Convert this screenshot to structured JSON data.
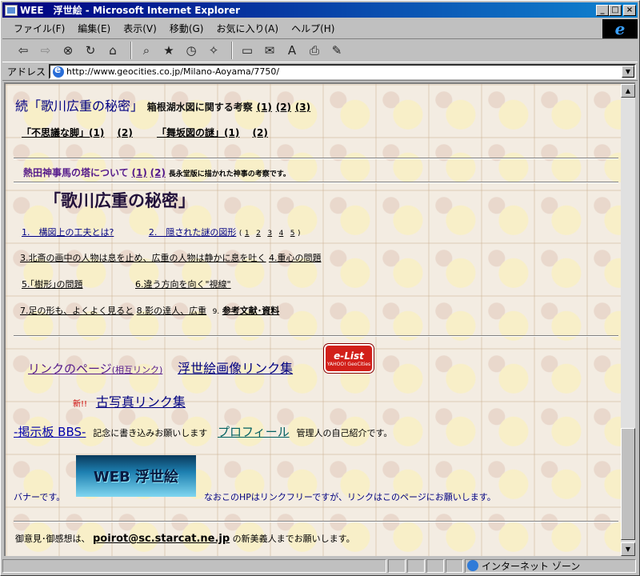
{
  "window": {
    "title": "WEE　浮世絵 - Microsoft Internet Explorer"
  },
  "menu": [
    "ファイル(F)",
    "編集(E)",
    "表示(V)",
    "移動(G)",
    "お気に入り(A)",
    "ヘルプ(H)"
  ],
  "address": {
    "label": "アドレス",
    "url": "http://www.geocities.co.jp/Milano-Aoyama/7750/"
  },
  "status": {
    "zone": "インターネット ゾーン"
  },
  "page": {
    "line1": {
      "title": "続「歌川広重の秘密」",
      "subtitle": "箱根湖水図に関する考察",
      "links": [
        "(1)",
        "(2)",
        "(3)"
      ]
    },
    "line2": {
      "a": "「不思議な脚」(1)",
      "a2": "(2)",
      "b": "「舞坂図の謎」(1)",
      "b2": "(2)"
    },
    "line3": {
      "text": "熱田神事馬の塔について",
      "links": [
        "(1)",
        "(2)"
      ],
      "note": "長永堂版に描かれた神事の考察です。"
    },
    "heading": "「歌川広重の秘密」",
    "toc": {
      "i1": "1.　構図上の工夫とは?",
      "i2": "2.　隠された謎の図形",
      "i2nums": [
        "1",
        "2",
        "3",
        "4",
        "5"
      ],
      "i2open": "(",
      "i2close": ")",
      "i3": "3.北斎の画中の人物は息を止め、広重の人物は静かに息を吐く",
      "i4": "4.重心の問題",
      "i5": "5.｢樹形｣の問題",
      "i6": "6.違う方向を向く\"視線\"",
      "i7": "7.足の形も、よくよく見ると",
      "i8": "8.影の達人、広重",
      "i9num": "9.",
      "i9": "参考文献･資料"
    },
    "links": {
      "link_page": "リンクのページ",
      "mutual": "(相互リンク)",
      "ukiyoe_links": "浮世絵画像リンク集",
      "new": "新!!",
      "photo_links": "古写真リンク集",
      "bbs": "-掲示板 BBS-",
      "bbs_desc": "記念に書き込みお願いします",
      "profile": "プロフィール",
      "profile_desc": "管理人の自己紹介です。"
    },
    "elist": {
      "top": "e-List",
      "bottom": "YAHOO! GeoCities"
    },
    "banner": {
      "left": "バナーです。",
      "label": "WEB 浮世絵",
      "right": "なおこのHPはリンクフリーですが、リンクはこのページにお願いします。"
    },
    "footer": {
      "pre": "御意見･御感想は、",
      "email": "poirot@sc.starcat.ne.jp",
      "post": "の新美義人までお願いします。"
    }
  }
}
